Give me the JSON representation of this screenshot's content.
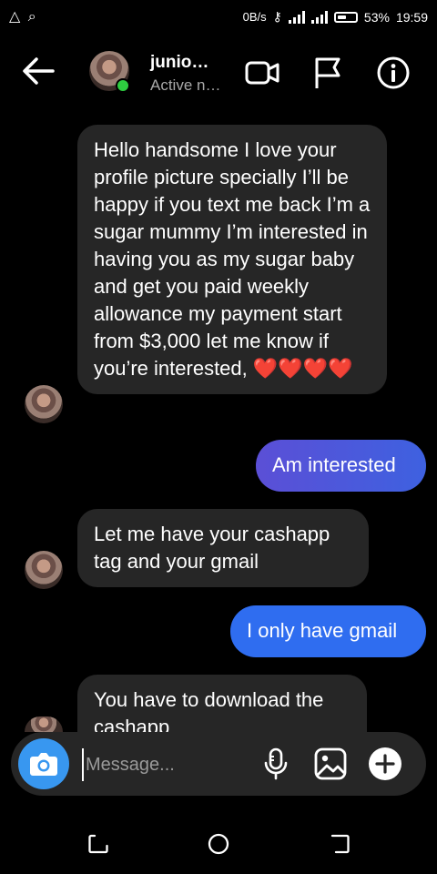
{
  "status_bar": {
    "left_icons": "△ ⌕",
    "network_speed": "0B/s",
    "battery_percent": "53%",
    "battery_level": 0.53,
    "time": "19:59"
  },
  "header": {
    "contact_name": "junio…",
    "contact_status": "Active n…"
  },
  "messages": [
    {
      "direction": "incoming",
      "text": "Hello handsome I love your profile picture specially I’ll be happy if you text me back I’m a sugar mummy I’m interested in having you as my sugar baby and get you paid weekly allowance my payment start from $3,000  let me know if you’re interested, ❤️❤️❤️❤️"
    },
    {
      "direction": "outgoing",
      "text": "Am interested"
    },
    {
      "direction": "incoming",
      "text": "Let me have your cashapp tag and your gmail"
    },
    {
      "direction": "outgoing",
      "text": "I only have gmail"
    },
    {
      "direction": "incoming",
      "text": "You have to download the cashapp"
    }
  ],
  "composer": {
    "placeholder": "Message..."
  },
  "colors": {
    "background": "#000000",
    "incoming_bubble": "#262626",
    "outgoing_gradient_start": "#5b4fd6",
    "outgoing_gradient_end": "#3e61e0",
    "outgoing_blue": "#2f6df0",
    "camera_button": "#3897f0",
    "online": "#2ecc40"
  }
}
